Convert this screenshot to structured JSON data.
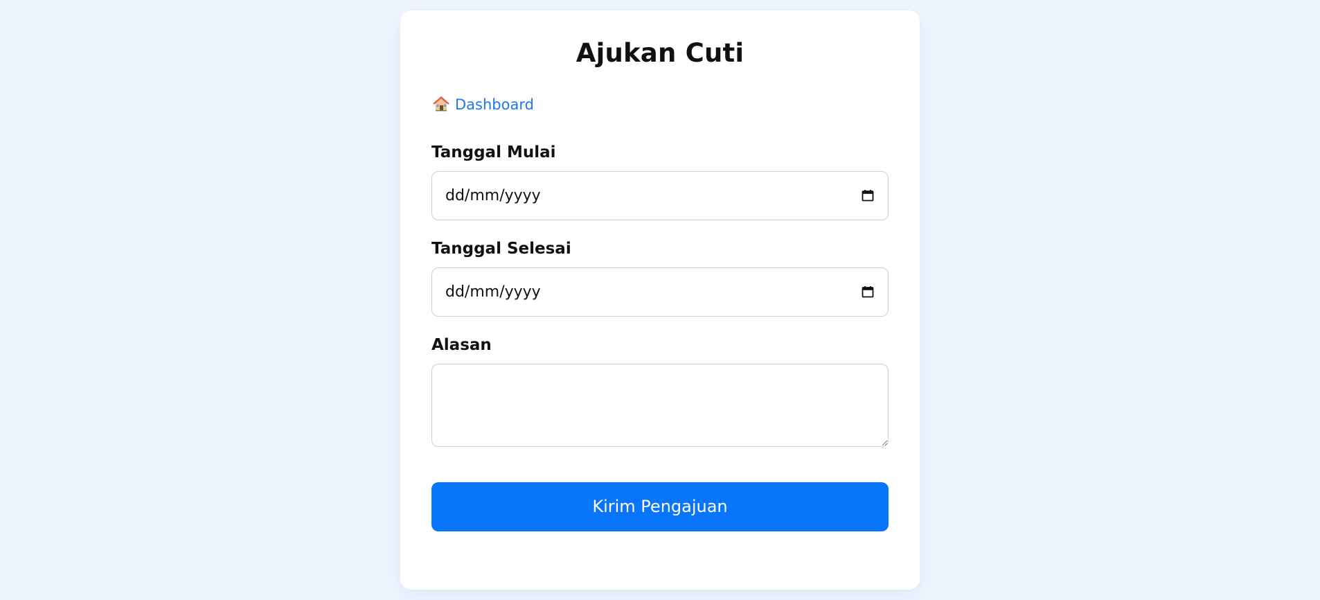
{
  "page": {
    "title": "Ajukan Cuti"
  },
  "nav": {
    "dashboard_label": "Dashboard",
    "icon": "house-icon"
  },
  "form": {
    "start_date": {
      "label": "Tanggal Mulai",
      "placeholder": "dd/mm/yyyy",
      "value": "",
      "icon": "calendar-icon"
    },
    "end_date": {
      "label": "Tanggal Selesai",
      "placeholder": "dd/mm/yyyy",
      "value": "",
      "icon": "calendar-icon"
    },
    "reason": {
      "label": "Alasan",
      "value": "",
      "placeholder": ""
    },
    "submit_label": "Kirim Pengajuan"
  },
  "colors": {
    "page_background": "#eef5ff",
    "card_background": "#ffffff",
    "accent": "#0975fa",
    "link": "#1f78e8",
    "input_border": "#d0d0d0"
  }
}
